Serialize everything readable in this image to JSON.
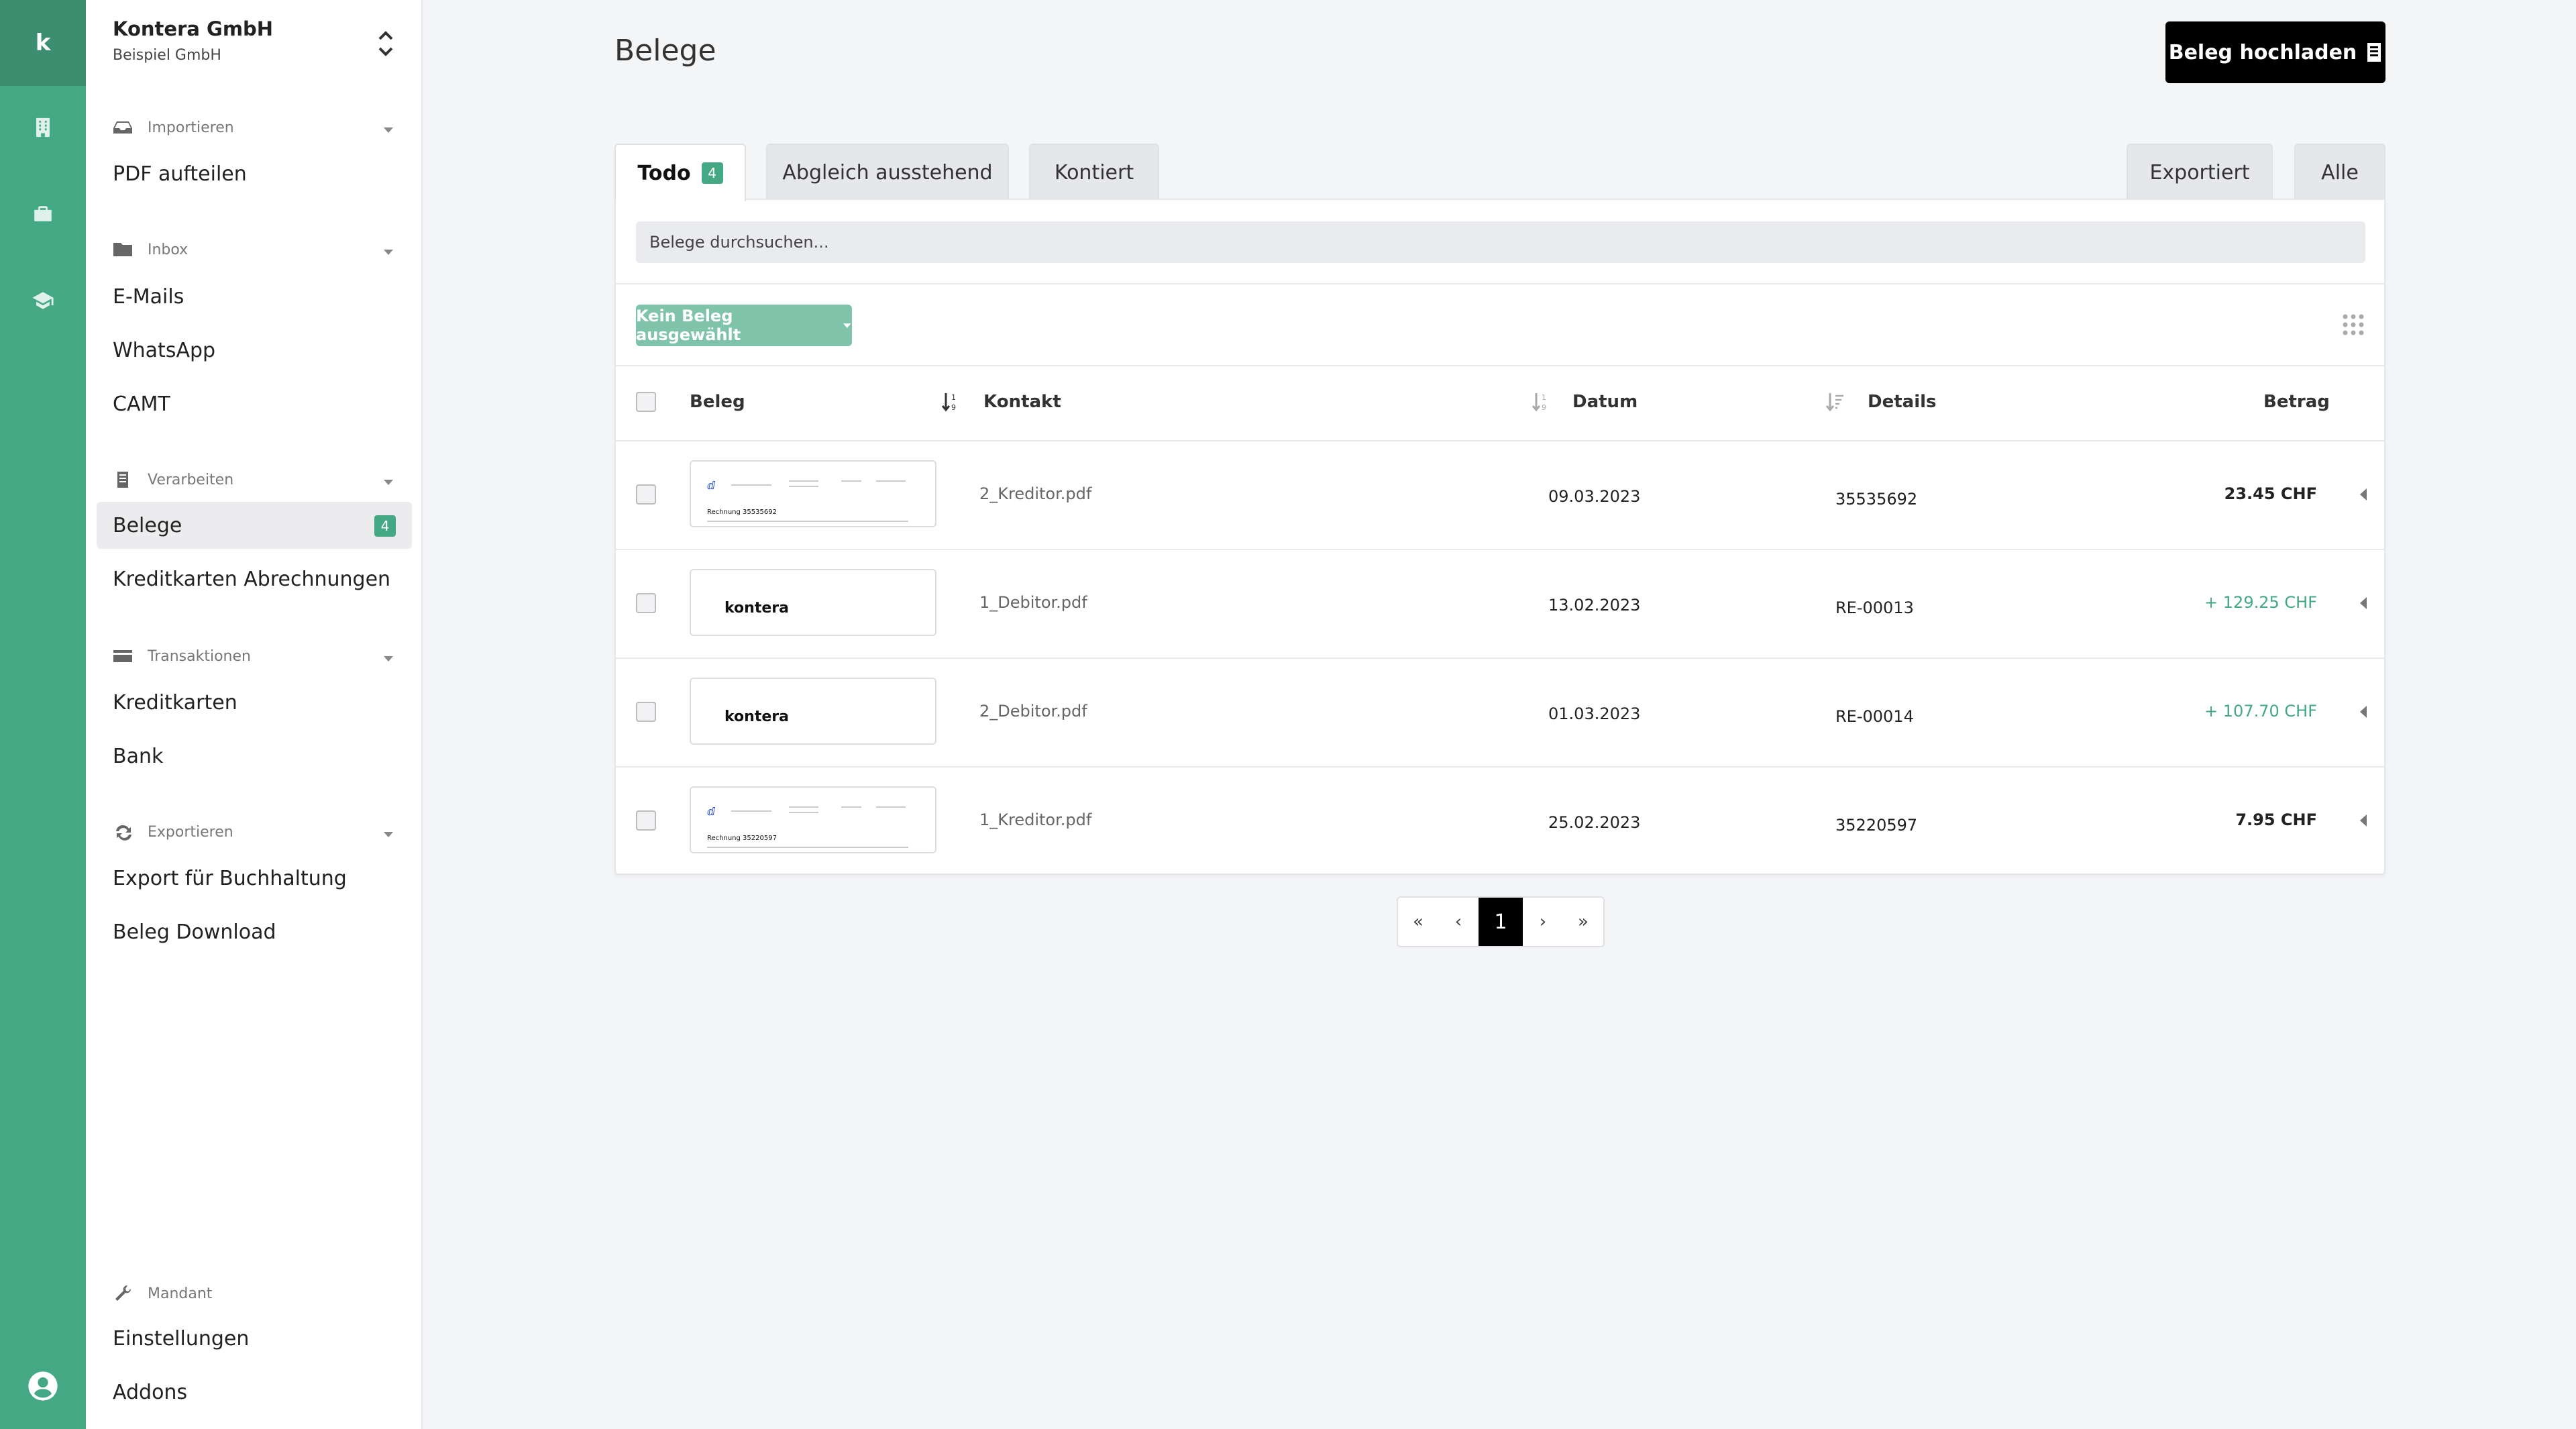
{
  "rail": {
    "logo_letter": "k"
  },
  "org": {
    "name": "Kontera GmbH",
    "sub": "Beispiel GmbH"
  },
  "sidebar": {
    "sections": {
      "importieren": {
        "title": "Importieren",
        "items": [
          "PDF aufteilen"
        ]
      },
      "inbox": {
        "title": "Inbox",
        "items": [
          "E-Mails",
          "WhatsApp",
          "CAMT"
        ]
      },
      "verarbeiten": {
        "title": "Verarbeiten",
        "items": [
          "Belege",
          "Kreditkarten Abrechnungen"
        ],
        "belege_badge": "4"
      },
      "transaktionen": {
        "title": "Transaktionen",
        "items": [
          "Kreditkarten",
          "Bank"
        ]
      },
      "exportieren": {
        "title": "Exportieren",
        "items": [
          "Export für Buchhaltung",
          "Beleg Download"
        ]
      },
      "mandant": {
        "title": "Mandant",
        "items": [
          "Einstellungen",
          "Addons"
        ]
      }
    }
  },
  "header": {
    "title": "Belege",
    "upload_label": "Beleg hochladen"
  },
  "tabs": {
    "todo": "Todo",
    "todo_badge": "4",
    "abgleich": "Abgleich ausstehend",
    "kontiert": "Kontiert",
    "exportiert": "Exportiert",
    "alle": "Alle"
  },
  "search": {
    "placeholder": "Belege durchsuchen..."
  },
  "bulk": {
    "label": "Kein Beleg ausgewählt"
  },
  "table": {
    "headers": {
      "beleg": "Beleg",
      "kontakt": "Kontakt",
      "datum": "Datum",
      "details": "Details",
      "betrag": "Betrag"
    },
    "rows": [
      {
        "file": "2_Kreditor.pdf",
        "date": "09.03.2023",
        "details": "35535692",
        "amount": "23.45 CHF",
        "positive": false,
        "thumb": "invoice",
        "invoice_no": "Rechnung 35535692"
      },
      {
        "file": "1_Debitor.pdf",
        "date": "13.02.2023",
        "details": "RE-00013",
        "amount": "+ 129.25 CHF",
        "positive": true,
        "thumb": "kontera",
        "thumb_text": "kontera"
      },
      {
        "file": "2_Debitor.pdf",
        "date": "01.03.2023",
        "details": "RE-00014",
        "amount": "+ 107.70 CHF",
        "positive": true,
        "thumb": "kontera",
        "thumb_text": "kontera"
      },
      {
        "file": "1_Kreditor.pdf",
        "date": "25.02.2023",
        "details": "35220597",
        "amount": "7.95 CHF",
        "positive": false,
        "thumb": "invoice",
        "invoice_no": "Rechnung 35220597"
      }
    ]
  },
  "pager": {
    "first": "«",
    "prev": "‹",
    "current": "1",
    "next": "›",
    "last": "»"
  },
  "colors": {
    "brand": "#45a884",
    "brand_light": "#7fc4aa",
    "positive": "#45a884"
  },
  "icons": [
    "building-icon",
    "briefcase-icon",
    "graduation-cap-icon",
    "user-circle-icon",
    "inbox-icon",
    "folder-icon",
    "document-icon",
    "credit-card-icon",
    "refresh-icon",
    "wrench-icon",
    "grid-icon",
    "sort-icon"
  ]
}
